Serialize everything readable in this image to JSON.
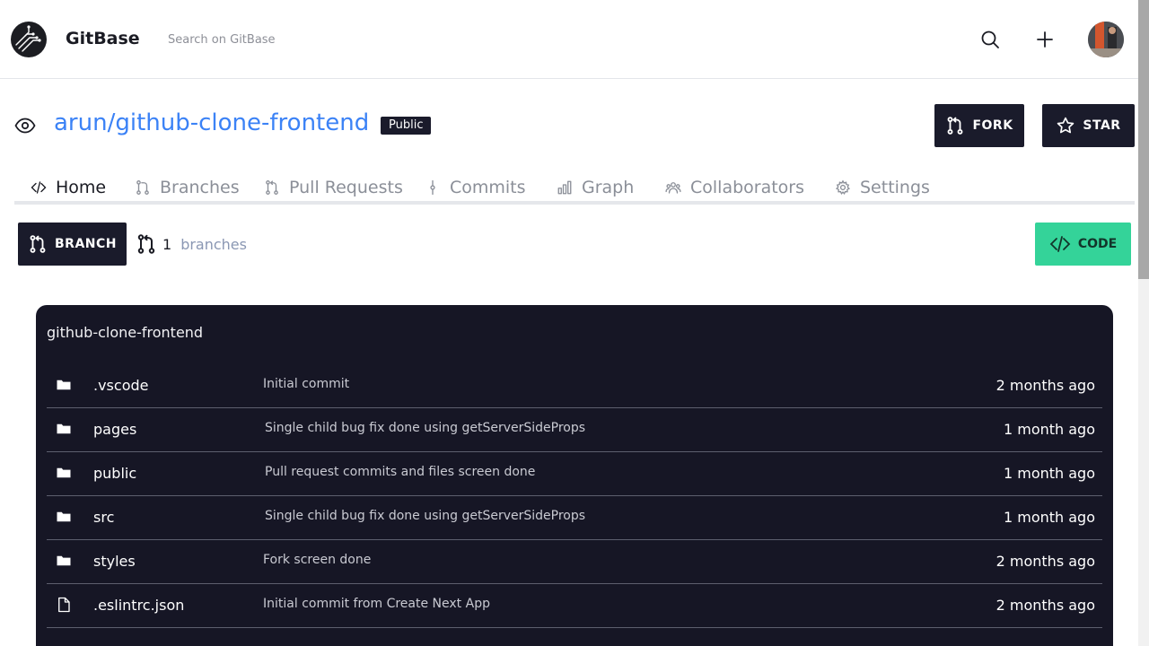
{
  "header": {
    "brand": "GitBase",
    "search_placeholder": "Search on GitBase"
  },
  "repo": {
    "name": "arun/github-clone-frontend",
    "visibility": "Public",
    "fork_label": "FORK",
    "star_label": "STAR"
  },
  "tabs": [
    {
      "label": "Home",
      "icon": "code-icon"
    },
    {
      "label": "Branches",
      "icon": "branch-icon"
    },
    {
      "label": "Pull Requests",
      "icon": "pull-request-icon"
    },
    {
      "label": "Commits",
      "icon": "commit-icon"
    },
    {
      "label": "Graph",
      "icon": "bar-chart-icon"
    },
    {
      "label": "Collaborators",
      "icon": "users-icon"
    },
    {
      "label": "Settings",
      "icon": "gear-icon"
    }
  ],
  "branch_bar": {
    "button_label": "BRANCH",
    "count": "1",
    "count_label": "branches",
    "code_label": "CODE"
  },
  "files": {
    "title": "github-clone-frontend",
    "rows": [
      {
        "name": ".vscode",
        "message": "Initial commit",
        "time": "2 months ago",
        "type": "folder"
      },
      {
        "name": "pages",
        "message": "Single child bug fix done using getServerSideProps",
        "time": "1 month ago",
        "type": "folder"
      },
      {
        "name": "public",
        "message": "Pull request commits and files screen done",
        "time": "1 month ago",
        "type": "folder"
      },
      {
        "name": "src",
        "message": "Single child bug fix done using getServerSideProps",
        "time": "1 month ago",
        "type": "folder"
      },
      {
        "name": "styles",
        "message": "Fork screen done",
        "time": "2 months ago",
        "type": "folder"
      },
      {
        "name": ".eslintrc.json",
        "message": "Initial commit from Create Next App",
        "time": "2 months ago",
        "type": "file"
      }
    ]
  },
  "colors": {
    "accent": "#3b82f6",
    "dark": "#1a1b2b",
    "panel": "#161625",
    "code_button": "#34d399"
  }
}
